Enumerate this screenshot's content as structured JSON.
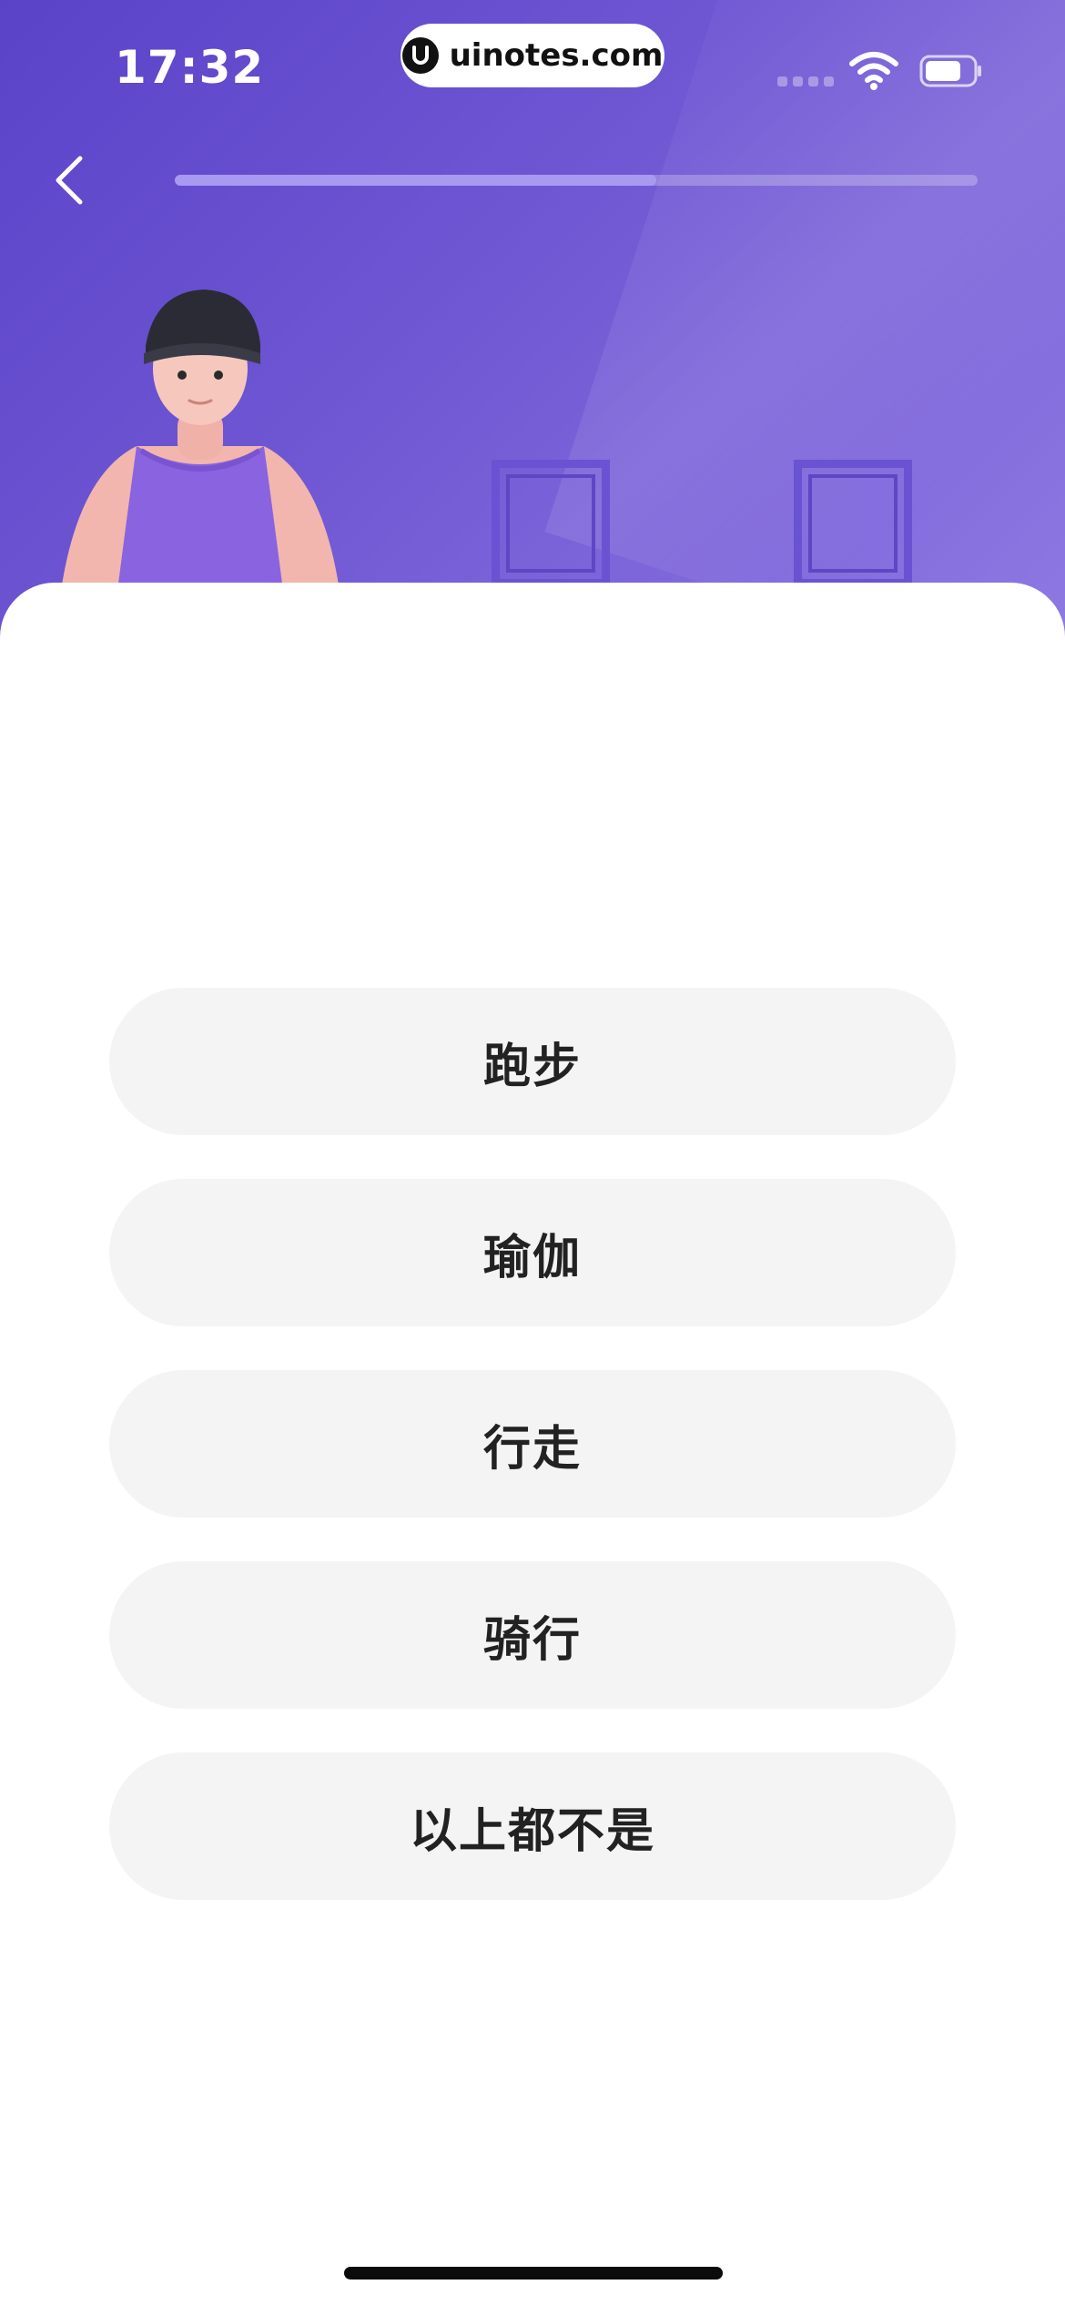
{
  "status_bar": {
    "time": "17:32",
    "watermark": "uinotes.com",
    "icons": [
      "signal-icon",
      "wifi-icon",
      "battery-icon"
    ]
  },
  "header": {
    "back_icon": "chevron-left-icon",
    "progress": 0.6
  },
  "colors": {
    "hero_gradient_start": "#5a43c8",
    "hero_gradient_end": "#8e79e2",
    "progress_fill": "#a99af1",
    "option_bg": "#f4f4f4",
    "option_text": "#222222"
  },
  "options": [
    {
      "label": "跑步"
    },
    {
      "label": "瑜伽"
    },
    {
      "label": "行走"
    },
    {
      "label": "骑行"
    },
    {
      "label": "以上都不是"
    }
  ]
}
